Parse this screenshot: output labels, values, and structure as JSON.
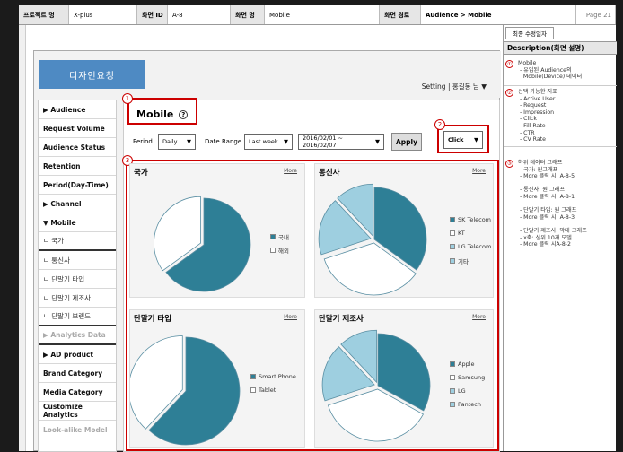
{
  "header": {
    "project_label": "프로젝트 명",
    "project_value": "X-plus",
    "screen_id_label": "화면 ID",
    "screen_id_value": "A-8",
    "screen_name_label": "화면 명",
    "screen_name_value": "Mobile",
    "path_label": "화면 경로",
    "path_value": "Audience > Mobile",
    "page": "Page 21"
  },
  "design_badge": "디자인요청",
  "setting_text": "Setting | 홍길동 님 ▼",
  "sidebar": {
    "items": [
      {
        "label": "▶ Audience",
        "style": "bold"
      },
      {
        "label": "Request Volume",
        "style": "bold"
      },
      {
        "label": "Audience Status",
        "style": "bold"
      },
      {
        "label": "Retention",
        "style": "bold"
      },
      {
        "label": "Period(Day-Time)",
        "style": "bold"
      },
      {
        "label": "▶ Channel",
        "style": "bold"
      },
      {
        "label": "▼ Mobile",
        "style": "bold"
      },
      {
        "label": "ㄴ 국가",
        "style": "sub"
      },
      {
        "label": "ㄴ 통신사",
        "style": "sub"
      },
      {
        "label": "ㄴ 단말기 타입",
        "style": "sub"
      },
      {
        "label": "ㄴ 단말기 제조사",
        "style": "sub"
      },
      {
        "label": "ㄴ 단말기 브랜드",
        "style": "sub"
      },
      {
        "label": "▶ Analytics Data",
        "style": "dis"
      },
      {
        "label": "▶ AD product",
        "style": "bold"
      },
      {
        "label": "Brand Category",
        "style": "bold"
      },
      {
        "label": "Media Category",
        "style": "bold"
      },
      {
        "label": "Customize Analytics",
        "style": "bold"
      },
      {
        "label": "Look-alike Model",
        "style": "dis"
      }
    ]
  },
  "main": {
    "title": "Mobile",
    "help_glyph": "?",
    "period_label": "Period",
    "period_value": "Daily",
    "date_range_label": "Date Range",
    "date_range_value": "Last week",
    "date_value": "2016/02/01 ~ 2016/02/07",
    "apply_label": "Apply",
    "metric_value": "Click",
    "more_label": "More"
  },
  "callouts": [
    "1",
    "2",
    "3"
  ],
  "colors": {
    "teal": "#2e7f96",
    "light_blue": "#9ecfe0",
    "white_slice": "#ffffff",
    "red": "#cc0000",
    "badge": "#4e8ac3"
  },
  "chart_data": [
    {
      "type": "pie",
      "title": "국가",
      "categories": [
        "국내",
        "해외"
      ],
      "values": [
        65,
        35
      ]
    },
    {
      "type": "pie",
      "title": "통신사",
      "categories": [
        "SK Telecom",
        "KT",
        "LG Telecom",
        "기타"
      ],
      "values": [
        35,
        35,
        18,
        12
      ]
    },
    {
      "type": "pie",
      "title": "단말기 타입",
      "categories": [
        "Smart Phone",
        "Tablet"
      ],
      "values": [
        62,
        38
      ]
    },
    {
      "type": "pie",
      "title": "단말기 제조사",
      "categories": [
        "Apple",
        "Samsung",
        "LG",
        "Pantech"
      ],
      "values": [
        33,
        37,
        18,
        12
      ]
    }
  ],
  "description": {
    "tab": "최종 수정일자",
    "heading": "Description(화면 설명)",
    "items": [
      {
        "num": "①",
        "text": "Mobile\n - 유입된 Audience의\n   Mobile(Device) 데이터"
      },
      {
        "num": "②",
        "text": "선택 가능한 지표\n - Active User\n - Request\n - Impression\n - Click\n - Fill Rate\n - CTR\n - CV Rate"
      },
      {
        "num": "③",
        "text": "하위 데이터 그래프\n - 국가: 원그래프\n - More 클릭 시: A-8-5\n\n - 통신사: 원 그래프\n - More 클릭 시: A-8-1\n\n - 단말기 타입: 원 그래프\n - More 클릭 시: A-8-3\n\n - 단말기 제조사: 막대 그래프\n - x축: 상위 10개 모델\n - More 클릭 시A-8-2"
      }
    ]
  }
}
